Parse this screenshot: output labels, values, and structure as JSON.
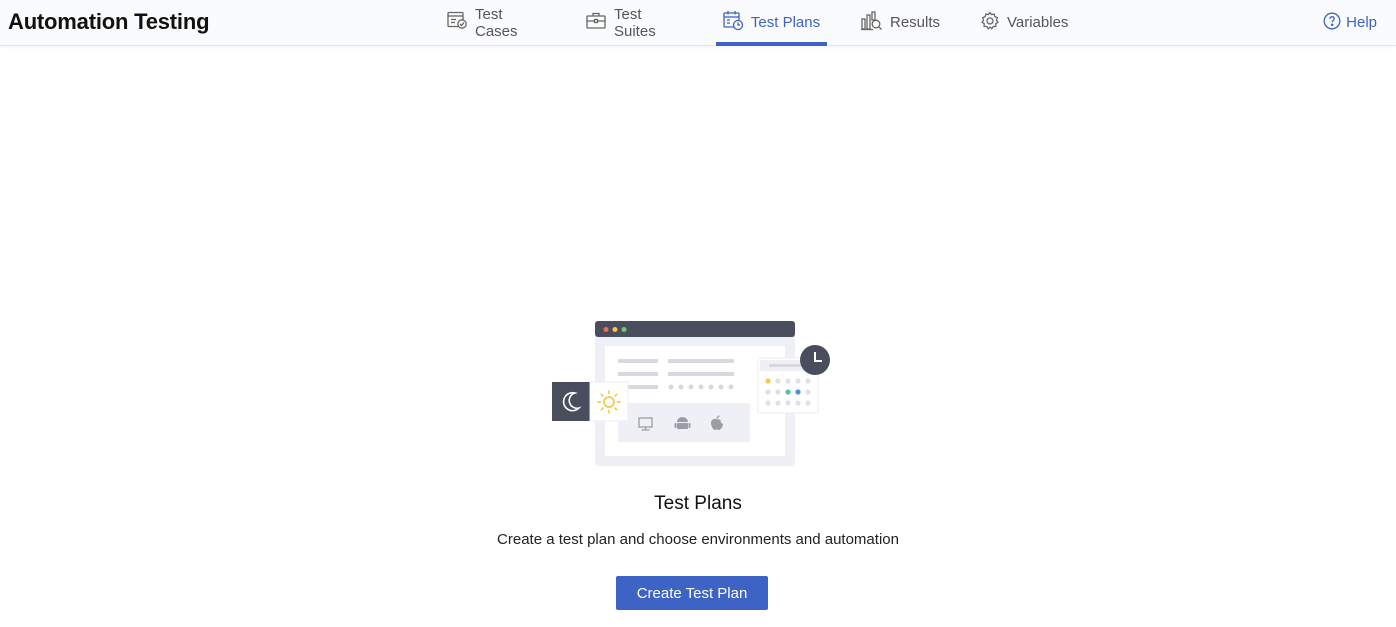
{
  "app": {
    "title": "Automation Testing"
  },
  "nav": {
    "tabs": [
      {
        "label": "Test Cases",
        "icon": "test-cases-icon",
        "active": false
      },
      {
        "label": "Test Suites",
        "icon": "briefcase-icon",
        "active": false
      },
      {
        "label": "Test Plans",
        "icon": "calendar-clock-icon",
        "active": true
      },
      {
        "label": "Results",
        "icon": "results-chart-icon",
        "active": false
      },
      {
        "label": "Variables",
        "icon": "gear-icon",
        "active": false
      }
    ],
    "help_label": "Help"
  },
  "empty_state": {
    "title": "Test Plans",
    "subtitle": "Create a test plan and choose environments and automation",
    "button_label": "Create Test Plan",
    "illustration": "test-plan-illustration"
  },
  "colors": {
    "accent": "#3d63c4",
    "text": "#222222",
    "header_bg": "#fafbfd",
    "illustration_dark": "#4a4e5c"
  }
}
